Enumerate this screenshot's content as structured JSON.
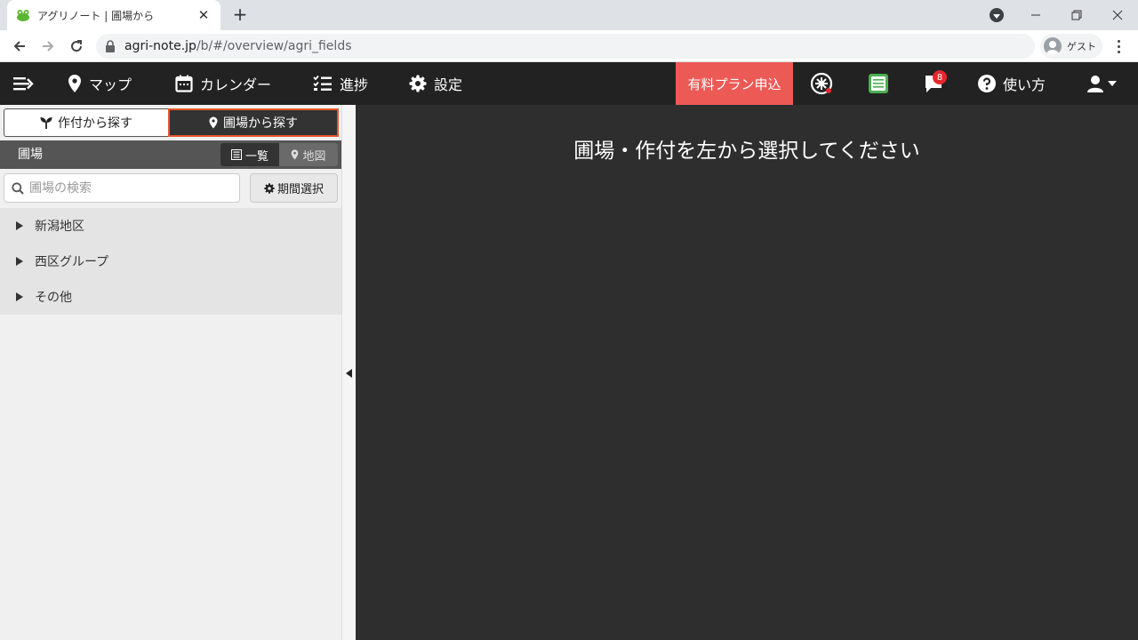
{
  "browser": {
    "tab_title": "アグリノート | 圃場から",
    "new_tab": "+",
    "url_host": "agri-note.jp",
    "url_path": "/b/#/overview/agri_fields",
    "profile_label": "ゲスト"
  },
  "nav": {
    "map": "マップ",
    "calendar": "カレンダー",
    "progress": "進捗",
    "settings": "設定",
    "plan": "有料プラン申込",
    "notification_count": "8",
    "help": "使い方"
  },
  "sidebar": {
    "tab_crop": "作付から探す",
    "tab_field": "圃場から探す",
    "header_title": "圃場",
    "view_list": "一覧",
    "view_map": "地図",
    "search_placeholder": "圃場の検索",
    "period_button": "期間選択",
    "groups": [
      {
        "label": "新潟地区"
      },
      {
        "label": "西区グループ"
      },
      {
        "label": "その他"
      }
    ]
  },
  "main": {
    "message": "圃場・作付を左から選択してください"
  },
  "colors": {
    "header_bg": "#222222",
    "plan_button": "#ec5a56",
    "active_tab_border": "#e8572a",
    "badge": "#e6262e",
    "main_bg": "#2e2e2e"
  }
}
